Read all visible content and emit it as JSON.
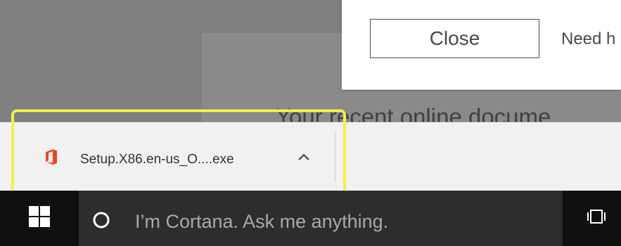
{
  "dialog": {
    "close_label": "Close",
    "need_help_text": "Need h"
  },
  "background": {
    "heading_text": "Your recent online docume"
  },
  "download_bar": {
    "file_name": "Setup.X86.en-us_O....exe",
    "file_icon": "office-icon",
    "menu_icon": "chevron-up-icon"
  },
  "taskbar": {
    "start_icon": "windows-logo-icon",
    "cortana_icon": "cortana-circle-icon",
    "search_placeholder": "I’m Cortana. Ask me anything.",
    "task_view_icon": "task-view-icon"
  },
  "colors": {
    "highlight": "#f4ef4a",
    "office_orange": "#e8481b",
    "taskbar_bg": "#101010",
    "search_bg": "#2d2d2d"
  }
}
